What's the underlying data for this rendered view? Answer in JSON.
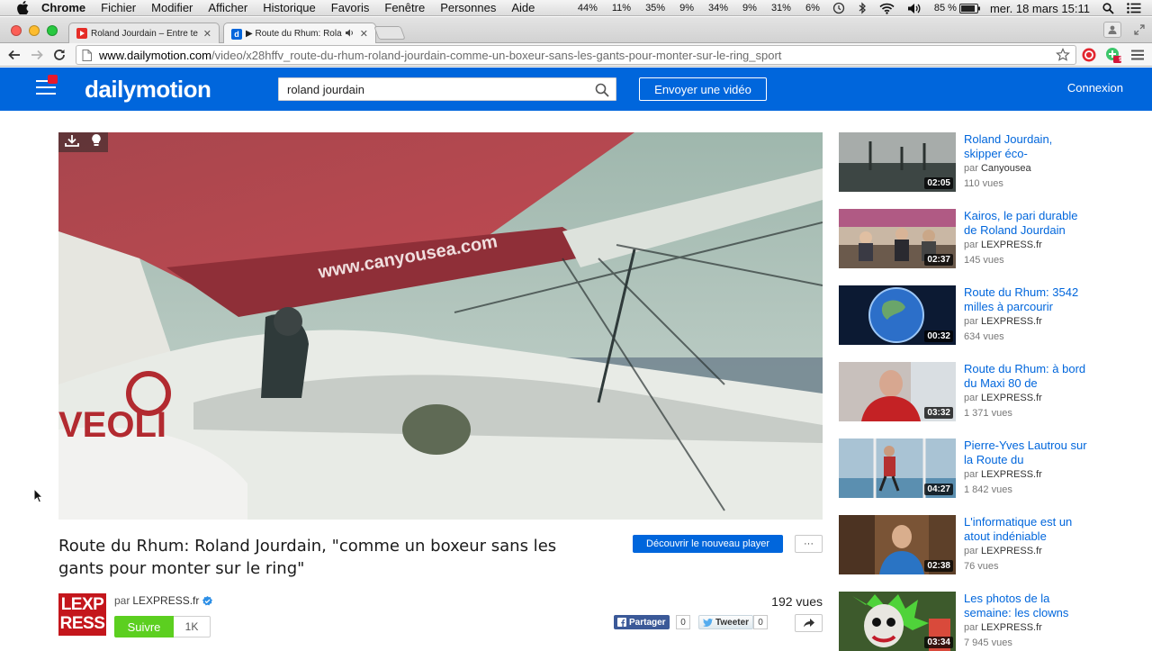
{
  "os_menubar": {
    "app_name": "Chrome",
    "menus": [
      "Fichier",
      "Modifier",
      "Afficher",
      "Historique",
      "Favoris",
      "Fenêtre",
      "Personnes",
      "Aide"
    ],
    "status_percents": [
      "44%",
      "11%",
      "35%",
      "9%",
      "34%",
      "9%",
      "31%",
      "6%"
    ],
    "battery": "85 %",
    "clock": "mer. 18 mars  15:11",
    "icons": [
      "time-machine-icon",
      "bluetooth-icon",
      "wifi-icon",
      "volume-icon",
      "battery-icon",
      "spotlight-icon",
      "notification-center-icon"
    ]
  },
  "browser": {
    "tabs": [
      {
        "title": "Roland Jourdain – Entre te",
        "favicon": "youtube-favicon",
        "active": false
      },
      {
        "title": "▶ Route du Rhum: Rola",
        "favicon": "dailymotion-favicon",
        "active": true,
        "audio": true
      }
    ],
    "url_host": "www.dailymotion.com",
    "url_path": "/video/x28hffv_route-du-rhum-roland-jourdain-comme-un-boxeur-sans-les-gants-pour-monter-sur-le-ring_sport",
    "extension_badge": "9"
  },
  "header": {
    "logo": "dailymotion",
    "search_value": "roland jourdain",
    "upload_label": "Envoyer une vidéo",
    "login_label": "Connexion"
  },
  "video": {
    "player_overlay_text": "www.canyousea.com",
    "hull_text": "VEOLI",
    "title": "Route du Rhum: Roland Jourdain, \"comme un boxeur sans les gants pour monter sur le ring\"",
    "discover_label": "Découvrir le nouveau player",
    "more_label": "···",
    "channel_logo_line1": "LEXP",
    "channel_logo_line2": "RESS",
    "by_prefix": "par",
    "channel_name": "LEXPRESS.fr",
    "follow_label": "Suivre",
    "follow_count": "1K",
    "views": "192 vues",
    "share_label": "Partager",
    "share_count": "0",
    "tweet_label": "Tweeter",
    "tweet_count": "0"
  },
  "related": [
    {
      "title": "Roland Jourdain, skipper éco-",
      "by": "par",
      "channel": "Canyousea",
      "views": "110 vues",
      "duration": "02:05"
    },
    {
      "title": "Kairos, le pari durable de Roland Jourdain",
      "by": "par",
      "channel": "LEXPRESS.fr",
      "views": "145 vues",
      "duration": "02:37"
    },
    {
      "title": "Route du Rhum: 3542 milles à parcourir",
      "by": "par",
      "channel": "LEXPRESS.fr",
      "views": "634 vues",
      "duration": "00:32"
    },
    {
      "title": "Route du Rhum: à bord du Maxi 80 de",
      "by": "par",
      "channel": "LEXPRESS.fr",
      "views": "1 371 vues",
      "duration": "03:32"
    },
    {
      "title": "Pierre-Yves Lautrou sur la Route du",
      "by": "par",
      "channel": "LEXPRESS.fr",
      "views": "1 842 vues",
      "duration": "04:27"
    },
    {
      "title": "L'informatique est un atout indéniable",
      "by": "par",
      "channel": "LEXPRESS.fr",
      "views": "76 vues",
      "duration": "02:38"
    },
    {
      "title": "Les photos de la semaine: les clowns",
      "by": "par",
      "channel": "LEXPRESS.fr",
      "views": "7 945 vues",
      "duration": "03:34"
    }
  ],
  "colors": {
    "brand_blue": "#0066dc",
    "follow_green": "#5ccf20",
    "lexpress_red": "#c4161c",
    "facebook_blue": "#3b5998"
  }
}
